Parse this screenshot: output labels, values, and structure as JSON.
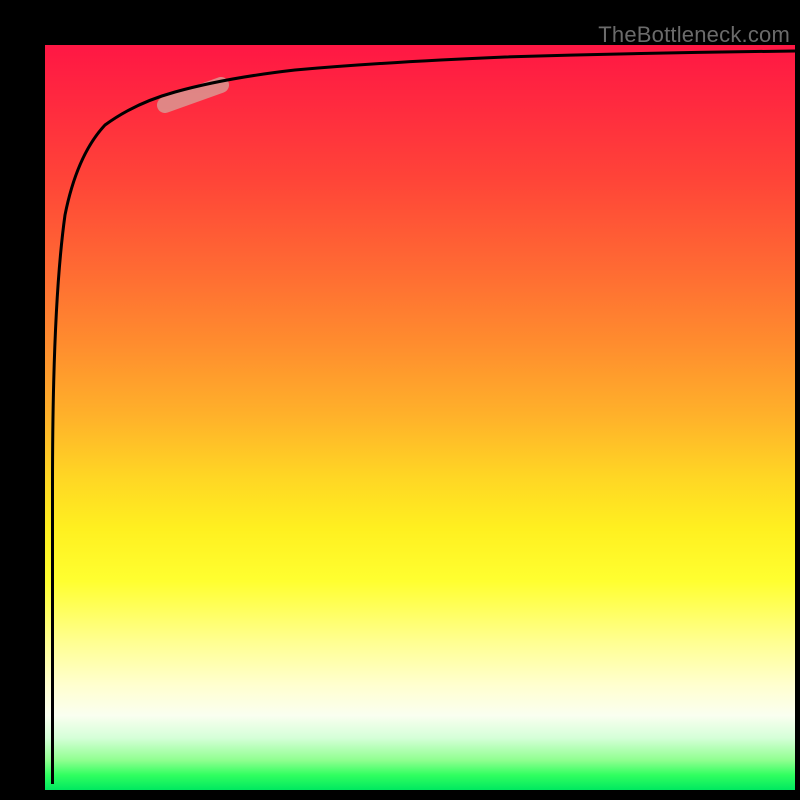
{
  "watermark": "TheBottleneck.com",
  "chart_data": {
    "type": "line",
    "title": "",
    "xlabel": "",
    "ylabel": "",
    "xlim": [
      0,
      100
    ],
    "ylim": [
      0,
      100
    ],
    "grid": false,
    "background_gradient": {
      "direction": "vertical",
      "top_color": "#ff1744",
      "bottom_color": "#00e860",
      "stops": [
        {
          "pct": 0,
          "color": "#ff1744"
        },
        {
          "pct": 50,
          "color": "#ffd624"
        },
        {
          "pct": 75,
          "color": "#ffff30"
        },
        {
          "pct": 100,
          "color": "#00e860"
        }
      ]
    },
    "series": [
      {
        "name": "curve",
        "x": [
          1.0,
          1.2,
          1.6,
          2.0,
          2.5,
          3.0,
          4.0,
          5.5,
          7.0,
          9.0,
          12.0,
          18.0,
          25.0,
          35.0,
          50.0,
          70.0,
          100.0
        ],
        "y": [
          0.5,
          55.0,
          72.0,
          80.0,
          85.0,
          87.5,
          90.0,
          92.0,
          93.3,
          94.3,
          95.3,
          96.2,
          97.0,
          97.5,
          98.1,
          98.6,
          99.0
        ]
      }
    ],
    "highlight_segment": {
      "x_start": 16,
      "x_end": 24,
      "note": "faded pink pill overlay on curve"
    }
  }
}
